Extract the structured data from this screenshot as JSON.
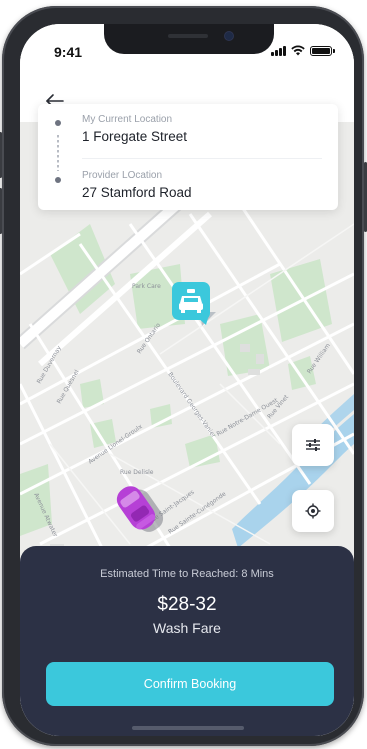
{
  "status_bar": {
    "time": "9:41",
    "icons": [
      "signal-icon",
      "wifi-icon",
      "battery-icon"
    ]
  },
  "header": {
    "back_icon": "arrow-left-icon"
  },
  "location_card": {
    "current": {
      "label": "My Current Location",
      "value": "1 Foregate Street"
    },
    "provider": {
      "label": "Provider LOcation",
      "value": "27 Stamford Road"
    }
  },
  "map": {
    "street_labels": [
      "Park Care",
      "Rue Ontario",
      "Boulevard Georges-Vanier",
      "Rue Notre-Dame Ouest",
      "Rue William",
      "Rue Duvernay",
      "Avenue Lionel-Groulx",
      "Rue Quesnel",
      "Rue Saint-Jacques",
      "Avenue Atwater",
      "Rue Delisle",
      "Rue Sainte-Cunégonde",
      "Rue Vinet"
    ],
    "filter_button_icon": "sliders-icon",
    "locate_button_icon": "target-icon",
    "taxi_marker_icon": "taxi-icon",
    "car_marker_icon": "car-icon",
    "colors": {
      "land": "#ececea",
      "park": "#cfe6cc",
      "water": "#a9d3ec",
      "road": "#ffffff",
      "marker_accent": "#3bc8dc",
      "car_color": "#b640d6"
    }
  },
  "booking_sheet": {
    "eta_text": "Estimated Time to Reached: 8 Mins",
    "price": "$28-32",
    "service": "Wash Fare",
    "confirm_label": "Confirm Booking",
    "colors": {
      "background": "#2c3145",
      "button": "#3bc8dc"
    }
  }
}
